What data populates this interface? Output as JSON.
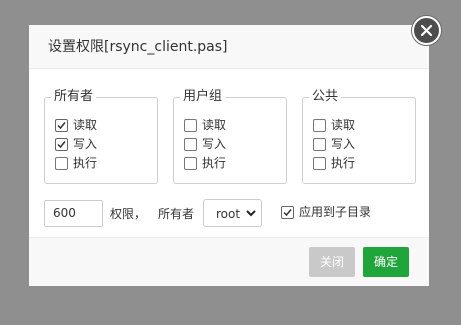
{
  "dialog": {
    "title": "设置权限[rsync_client.pas]"
  },
  "groups": [
    {
      "legend": "所有者",
      "items": [
        {
          "label": "读取",
          "checked": true
        },
        {
          "label": "写入",
          "checked": true
        },
        {
          "label": "执行",
          "checked": false
        }
      ]
    },
    {
      "legend": "用户组",
      "items": [
        {
          "label": "读取",
          "checked": false
        },
        {
          "label": "写入",
          "checked": false
        },
        {
          "label": "执行",
          "checked": false
        }
      ]
    },
    {
      "legend": "公共",
      "items": [
        {
          "label": "读取",
          "checked": false
        },
        {
          "label": "写入",
          "checked": false
        },
        {
          "label": "执行",
          "checked": false
        }
      ]
    }
  ],
  "permission": {
    "value": "600",
    "suffix": "权限，",
    "owner_label": "所有者",
    "owner_value": "root",
    "apply_subdirs_label": "应用到子目录",
    "apply_subdirs_checked": true
  },
  "footer": {
    "close_label": "关闭",
    "ok_label": "确定"
  },
  "colors": {
    "overlay": "#8f8f8f",
    "ok_button": "#20a53a",
    "close_button": "#c9c9c9",
    "close_icon_bg": "#4d4d4d"
  }
}
